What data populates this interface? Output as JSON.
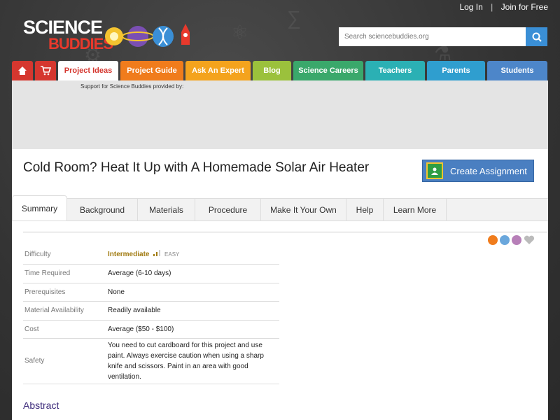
{
  "header": {
    "login_label": "Log In",
    "separator": "|",
    "join_label": "Join for Free",
    "logo_line1": "SCIENCE",
    "logo_line2": "BUDDIES"
  },
  "search": {
    "placeholder": "Search sciencebuddies.org"
  },
  "nav": {
    "items": [
      {
        "label": "Project Ideas",
        "color": "#ffffff",
        "text_color": "#d5372f"
      },
      {
        "label": "Project Guide",
        "color": "#f07c1c"
      },
      {
        "label": "Ask An Expert",
        "color": "#f4a31d"
      },
      {
        "label": "Blog",
        "color": "#9bc13c"
      },
      {
        "label": "Science Careers",
        "color": "#3aa86b"
      },
      {
        "label": "Teachers",
        "color": "#2bb0b4"
      },
      {
        "label": "Parents",
        "color": "#2f9ecf"
      },
      {
        "label": "Students",
        "color": "#4d86c9"
      }
    ],
    "home_icon": "home-icon",
    "cart_icon": "cart-icon",
    "accent": "#d5372f"
  },
  "ad": {
    "support_text": "Support for Science Buddies provided by:"
  },
  "page": {
    "title": "Cold Room? Heat It Up with A Homemade Solar Air Heater",
    "create_assignment": "Create Assignment"
  },
  "subtabs": [
    "Summary",
    "Background",
    "Materials",
    "Procedure",
    "Make It Your Own",
    "Help",
    "Learn More"
  ],
  "details": [
    {
      "key": "Difficulty",
      "value": "Intermediate",
      "sub": "EASY"
    },
    {
      "key": "Time Required",
      "value": "Average (6-10 days)"
    },
    {
      "key": "Prerequisites",
      "value": "None"
    },
    {
      "key": "Material Availability",
      "value": "Readily available"
    },
    {
      "key": "Cost",
      "value": "Average ($50 - $100)"
    },
    {
      "key": "Safety",
      "value": "You need to cut cardboard for this project and use paint. Always exercise caution when using a sharp knife and scissors. Paint in an area with good ventilation."
    }
  ],
  "abstract_heading": "Abstract"
}
